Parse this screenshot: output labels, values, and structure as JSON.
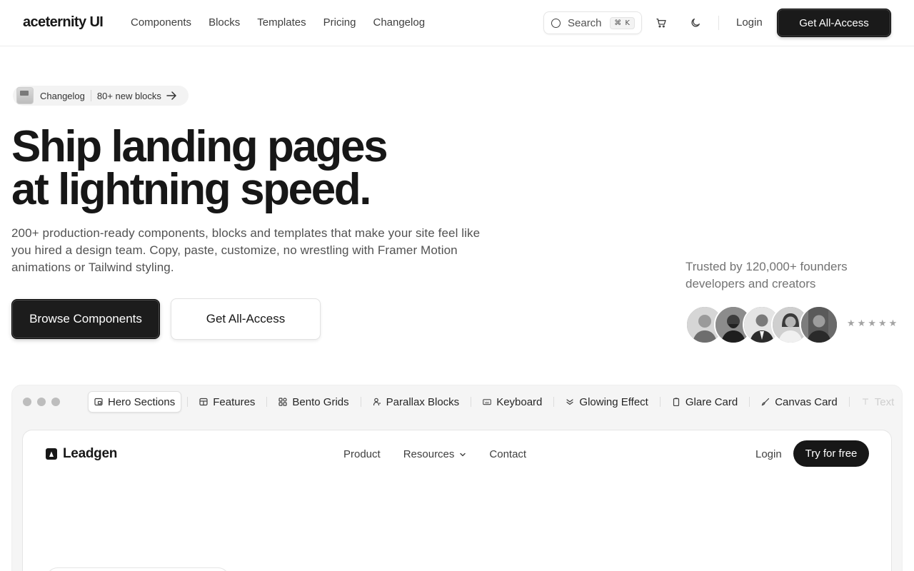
{
  "nav": {
    "logo": "aceternity UI",
    "links": [
      "Components",
      "Blocks",
      "Templates",
      "Pricing",
      "Changelog"
    ],
    "search_label": "Search",
    "search_shortcut": "⌘ K",
    "login": "Login",
    "cta": "Get All-Access"
  },
  "pill": {
    "label": "Changelog",
    "text": "80+ new blocks"
  },
  "hero": {
    "title_line1": "Ship landing pages",
    "title_line2": "at lightning speed.",
    "subtitle": "200+ production-ready components, blocks and templates that make your site feel like you hired a design team. Copy, paste, customize, no wrestling with Framer Motion animations or Tailwind styling.",
    "primary_cta": "Browse Components",
    "secondary_cta": "Get All-Access"
  },
  "trusted": {
    "text": "Trusted by 120,000+ founders developers and creators",
    "rating_stars": 5
  },
  "preview": {
    "tabs": [
      {
        "label": "Hero Sections",
        "icon": "hero-sections-icon",
        "active": true
      },
      {
        "label": "Features",
        "icon": "features-icon"
      },
      {
        "label": "Bento Grids",
        "icon": "bento-grid-icon"
      },
      {
        "label": "Parallax Blocks",
        "icon": "parallax-icon"
      },
      {
        "label": "Keyboard",
        "icon": "keyboard-icon"
      },
      {
        "label": "Glowing Effect",
        "icon": "glow-icon"
      },
      {
        "label": "Glare Card",
        "icon": "glare-card-icon"
      },
      {
        "label": "Canvas Card",
        "icon": "canvas-card-icon"
      },
      {
        "label": "Text",
        "icon": "text-icon"
      }
    ],
    "demo": {
      "logo": "Leadgen",
      "nav": [
        "Product",
        "Resources",
        "Contact"
      ],
      "login": "Login",
      "cta": "Try for free"
    }
  }
}
